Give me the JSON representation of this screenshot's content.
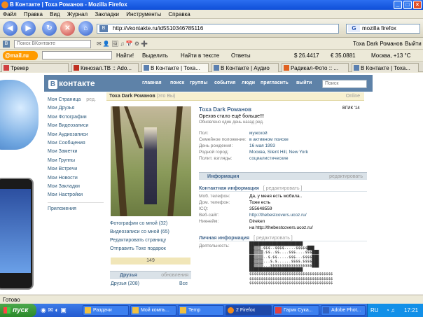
{
  "window": {
    "title": "В Контакте | Тоха Романов - Mozilla Firefox",
    "controls": [
      "_",
      "□",
      "×"
    ]
  },
  "menu": [
    "Файл",
    "Правка",
    "Вид",
    "Журнал",
    "Закладки",
    "Инструменты",
    "Справка"
  ],
  "nav": {
    "url": "http://vkontakte.ru/id5510346?85116",
    "search_value": "mozilla firefox",
    "fav_label": "В"
  },
  "toolbar1": {
    "search_placeholder": "Поиск ВКонтакте",
    "logout": "Выйти"
  },
  "toolbar2": {
    "mail_logo": "@mail.ru",
    "find_button": "Найти!",
    "highlight": "Выделить",
    "find_in_text": "Найти в тексте",
    "answers": "Ответы",
    "user_name": "Тоха Dark Романов",
    "usd": "$ 26.4417",
    "eur": "€ 35.0881",
    "weather": "Москва, +13 °C"
  },
  "tabs": [
    {
      "label": "Трекер"
    },
    {
      "label": "Кинозал.ТВ :: Ado..."
    },
    {
      "label": "В Контакте | Тоха..."
    },
    {
      "label": "В Контакте | Аудио"
    },
    {
      "label": "Радикал-Фото :: ..."
    },
    {
      "label": "В Контакте | Тоха..."
    }
  ],
  "vk": {
    "logo_b": "В",
    "logo_text": "контакте",
    "topnav": [
      "главная",
      "поиск",
      "группы",
      "события",
      "люди",
      "пригласить",
      "выйти"
    ],
    "search_placeholder": "Поиск",
    "leftnav": [
      "Моя Страница",
      "Мои Друзья",
      "Мои Фотографии",
      "Мои Видеозаписи",
      "Мои Аудиозаписи",
      "Мои Сообщения",
      "Мои Заметки",
      "Мои Группы",
      "Мои Встречи",
      "Мои Новости",
      "Мои Закладки",
      "Мои Настройки"
    ],
    "leftnav_edit": "ред.",
    "apps": "Приложения",
    "namebar": {
      "name": "Тоха Dark Романов",
      "this_is_you": "(это Вы)",
      "online": "Online"
    },
    "photo_links": [
      "Фотографии со мной (32)",
      "Видеозаписи со мной (65)",
      "Редактировать страницу",
      "Отправить Тохе подарок"
    ],
    "rating": "149",
    "friends": {
      "title": "Друзья",
      "updates": "обновления",
      "count": "Друзья (208)",
      "all": "Все"
    },
    "profile": {
      "name": "Тоха Dark Романов",
      "school": "ВГИК '14",
      "status": "Орехов стало ещё больше!!!",
      "updated": "Обновлено один день назад ред.",
      "fields": [
        {
          "label": "Пол:",
          "value": "мужской"
        },
        {
          "label": "Семейное положение:",
          "value": "в активном поиске"
        },
        {
          "label": "День рождения:",
          "value": "16 мая 1993"
        },
        {
          "label": "Родной город:",
          "value": "Москва, Silent Hill, New York"
        },
        {
          "label": "Полит. взгляды:",
          "value": "социалистические"
        }
      ],
      "info_header": "Информация",
      "edit": "редактировать",
      "contact_header": "Контактная информация",
      "contact_edit": "[ редактировать ]",
      "contacts": [
        {
          "label": "Моб. телефон:",
          "value": "Да, у меня есть мобила.."
        },
        {
          "label": "Дом. телефон:",
          "value": "Тоже есть"
        },
        {
          "label": "ICQ:",
          "value": "355648559"
        },
        {
          "label": "Веб-сайт:",
          "value": "http://thebestcovers.ucoz.ru/"
        },
        {
          "label": "Никнейм:",
          "value": "Direken"
        }
      ],
      "nickname_extra": "на http://thebestcovers.ucoz.ru/",
      "personal_header": "Личная информация",
      "personal_edit": "[ редактировать ]",
      "activity_label": "Деятельность:",
      "activity_art": [
        "███████████████████████",
        "██▒▒▒.$$$..$$$$.....$$$$$███",
        "██▒▒▒▒.$$..$$....$$$....$$$███",
        "██▒▒▒▒..$.$$.....$$$...$$$$███",
        "██▒▒▒▒...$.$......$$$$.$$$$███",
        "██▒▒▒▒...$$$$$$$$$$$$$$$$$$███",
        "███████████████████████",
        "$$$$$$$$$$$$$$$$$$$$$$$$$$$$$$$$$$$$",
        "$$$$$$$$$$$$$$$$$$$$$$$$$$$$$$$$$$$$",
        "$$$$$$$$$$$$$$$$$$$$$$$$$$$$$$$$$$$$"
      ]
    }
  },
  "statusbar": "Готово",
  "taskbar": {
    "start": "пуск",
    "items": [
      "Раздачи",
      "Мой компь...",
      "Temp",
      "2 Firefox",
      "Гарик Сука...",
      "Adobe Phot..."
    ],
    "lang": "RU",
    "clock": "17:21"
  }
}
